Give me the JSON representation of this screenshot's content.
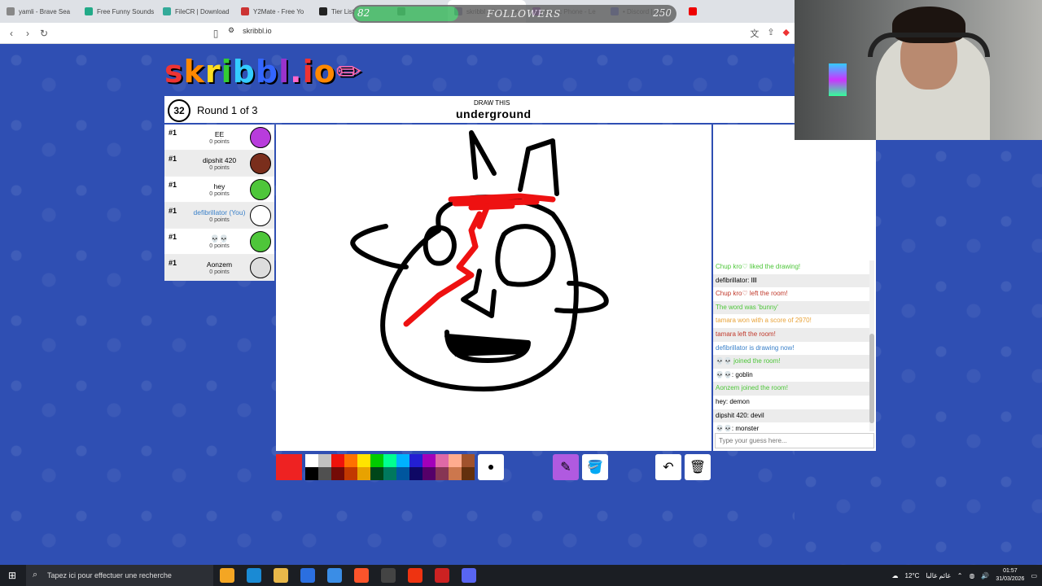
{
  "tabs": [
    {
      "title": "yamli - Brave Sea",
      "color": "#888"
    },
    {
      "title": "Free Funny Sounds",
      "color": "#2a8"
    },
    {
      "title": "FileCR | Download",
      "color": "#3a9"
    },
    {
      "title": "Y2Mate - Free Yo",
      "color": "#c33"
    },
    {
      "title": "Tier List",
      "color": "#222"
    },
    {
      "title": "",
      "color": "#666"
    },
    {
      "title": "skribbl - Free",
      "color": "#77a",
      "active": true
    },
    {
      "title": "Gartic Phone - Le",
      "color": "#93c"
    },
    {
      "title": "• Discord | Lobby",
      "color": "#5865f2"
    },
    {
      "title": "",
      "color": "#e00"
    }
  ],
  "overlay": {
    "level": "82",
    "title": "FOLLOWERS",
    "goal": "250"
  },
  "address": {
    "url": "skribbl.io"
  },
  "logo": [
    "s",
    "k",
    "r",
    "i",
    "b",
    "b",
    "l",
    ".",
    "i",
    "o"
  ],
  "logo_colors": [
    "#e33",
    "#f80",
    "#fd2",
    "#3c3",
    "#3cf",
    "#36f",
    "#93c",
    "#f6c",
    "#e33",
    "#f80"
  ],
  "game": {
    "timer": "32",
    "round": "Round 1 of 3",
    "draw_this": "DRAW THIS",
    "word": "underground"
  },
  "players": [
    {
      "rank": "#1",
      "name": "EE",
      "points": "0 points",
      "color": "#b83cdc",
      "me": false
    },
    {
      "rank": "#1",
      "name": "dipshit 420",
      "points": "0 points",
      "color": "#7a2e1c",
      "me": false
    },
    {
      "rank": "#1",
      "name": "hey",
      "points": "0 points",
      "color": "#4ec63a",
      "me": false
    },
    {
      "rank": "#1",
      "name": "defibrillator (You)",
      "points": "0 points",
      "color": "#ffffff",
      "me": true
    },
    {
      "rank": "#1",
      "name": "💀💀",
      "points": "0 points",
      "color": "#4ec63a",
      "me": false
    },
    {
      "rank": "#1",
      "name": "Aonzem",
      "points": "0 points",
      "color": "#dddddd",
      "me": false
    }
  ],
  "chat": [
    {
      "text": "Chup kro♡ liked the drawing!",
      "color": "#4ec63a"
    },
    {
      "text": "defibrillator: llll",
      "color": "#000000"
    },
    {
      "text": "Chup kro♡ left the room!",
      "color": "#c0392b"
    },
    {
      "text": "The word was 'bunny'",
      "color": "#4ec63a"
    },
    {
      "text": "tamara won with a score of 2970!",
      "color": "#e8a33a"
    },
    {
      "text": "tamara left the room!",
      "color": "#c0392b"
    },
    {
      "text": "defibrillator is drawing now!",
      "color": "#3a80c9"
    },
    {
      "text": "💀💀 joined the room!",
      "color": "#4ec63a"
    },
    {
      "text": "💀💀: goblin",
      "color": "#000000"
    },
    {
      "text": "Aonzem joined the room!",
      "color": "#4ec63a"
    },
    {
      "text": "hey: demon",
      "color": "#000000"
    },
    {
      "text": "dipshit 420: devil",
      "color": "#000000"
    },
    {
      "text": "💀💀: monster",
      "color": "#000000"
    }
  ],
  "guess_placeholder": "Type your guess here...",
  "palette": [
    "#ffffff",
    "#c1c1c1",
    "#ef130b",
    "#ff7100",
    "#ffe400",
    "#00cc00",
    "#00ff91",
    "#00b2ff",
    "#231fd3",
    "#a300ba",
    "#df69a7",
    "#ffac8e",
    "#a0522d",
    "#000000",
    "#505050",
    "#740b07",
    "#c23800",
    "#e8a200",
    "#004619",
    "#00785d",
    "#00569e",
    "#0e0865",
    "#550069",
    "#873554",
    "#cc774d",
    "#63300d"
  ],
  "tool_icons": [
    "pencil-icon",
    "fill-icon",
    "undo-icon",
    "trash-icon"
  ],
  "taskbar": {
    "search": "Tapez ici pour effectuer une recherche",
    "weather": "12°C",
    "weather_text": "غائم غالبا",
    "time": "01:57",
    "date": "31/03/2026"
  }
}
